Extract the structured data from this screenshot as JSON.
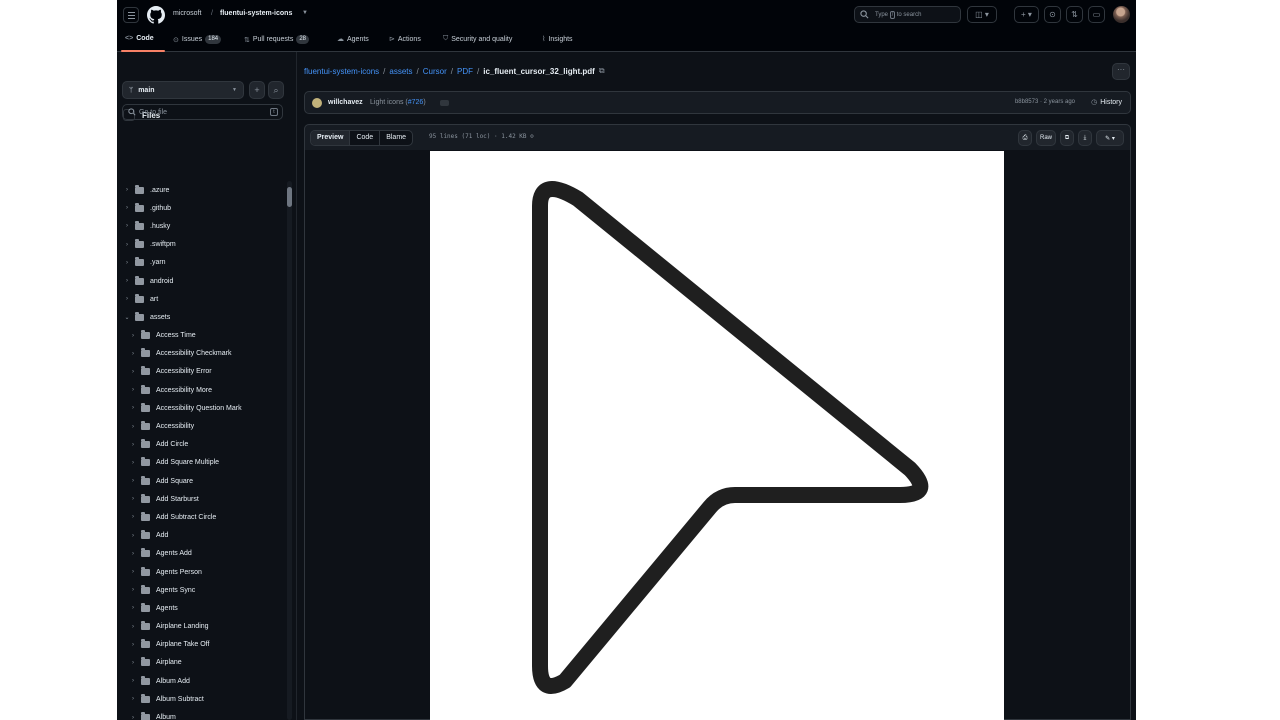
{
  "header": {
    "owner": "microsoft",
    "repo": "fluentui-system-icons",
    "search_placeholder": "Type",
    "search_key": "/",
    "search_suffix": "to search"
  },
  "repo_nav": {
    "tabs": [
      {
        "label": "Code",
        "count": ""
      },
      {
        "label": "Issues",
        "count": "184"
      },
      {
        "label": "Pull requests",
        "count": "28"
      },
      {
        "label": "Agents",
        "count": ""
      },
      {
        "label": "Actions",
        "count": ""
      },
      {
        "label": "Security and quality",
        "count": ""
      },
      {
        "label": "Insights",
        "count": ""
      }
    ]
  },
  "sidebar": {
    "title": "Files",
    "branch": "main",
    "goto_placeholder": "Go to file",
    "goto_key": "t",
    "items": [
      {
        "label": ".azure",
        "level": 0,
        "expanded": false
      },
      {
        "label": ".github",
        "level": 0,
        "expanded": false
      },
      {
        "label": ".husky",
        "level": 0,
        "expanded": false
      },
      {
        "label": ".swiftpm",
        "level": 0,
        "expanded": false
      },
      {
        "label": ".yarn",
        "level": 0,
        "expanded": false
      },
      {
        "label": "android",
        "level": 0,
        "expanded": false
      },
      {
        "label": "art",
        "level": 0,
        "expanded": false
      },
      {
        "label": "assets",
        "level": 0,
        "expanded": true
      },
      {
        "label": "Access Time",
        "level": 1,
        "expanded": false
      },
      {
        "label": "Accessibility Checkmark",
        "level": 1,
        "expanded": false
      },
      {
        "label": "Accessibility Error",
        "level": 1,
        "expanded": false
      },
      {
        "label": "Accessibility More",
        "level": 1,
        "expanded": false
      },
      {
        "label": "Accessibility Question Mark",
        "level": 1,
        "expanded": false
      },
      {
        "label": "Accessibility",
        "level": 1,
        "expanded": false
      },
      {
        "label": "Add Circle",
        "level": 1,
        "expanded": false
      },
      {
        "label": "Add Square Multiple",
        "level": 1,
        "expanded": false
      },
      {
        "label": "Add Square",
        "level": 1,
        "expanded": false
      },
      {
        "label": "Add Starburst",
        "level": 1,
        "expanded": false
      },
      {
        "label": "Add Subtract Circle",
        "level": 1,
        "expanded": false
      },
      {
        "label": "Add",
        "level": 1,
        "expanded": false
      },
      {
        "label": "Agents Add",
        "level": 1,
        "expanded": false
      },
      {
        "label": "Agents Person",
        "level": 1,
        "expanded": false
      },
      {
        "label": "Agents Sync",
        "level": 1,
        "expanded": false
      },
      {
        "label": "Agents",
        "level": 1,
        "expanded": false
      },
      {
        "label": "Airplane Landing",
        "level": 1,
        "expanded": false
      },
      {
        "label": "Airplane Take Off",
        "level": 1,
        "expanded": false
      },
      {
        "label": "Airplane",
        "level": 1,
        "expanded": false
      },
      {
        "label": "Album Add",
        "level": 1,
        "expanded": false
      },
      {
        "label": "Album Subtract",
        "level": 1,
        "expanded": false
      },
      {
        "label": "Album",
        "level": 1,
        "expanded": false
      }
    ]
  },
  "breadcrumb": [
    "fluentui-system-icons",
    "assets",
    "Cursor",
    "PDF"
  ],
  "file_name": "ic_fluent_cursor_32_light.pdf",
  "commit": {
    "author": "willchavez",
    "message": "Light icons (",
    "pr": "#726",
    "message_end": ")",
    "meta": "b8b8573 · 2 years ago",
    "history_label": "History"
  },
  "file_view": {
    "tabs": [
      "Preview",
      "Code",
      "Blame"
    ],
    "info": "95 lines (71 loc) · 1.42 KB",
    "raw_label": "Raw"
  },
  "colors": {
    "background": "#0d1117",
    "header": "#010409",
    "link": "#4493f8",
    "active_tab_underline": "#f78166",
    "cursor_stroke": "#1f1f1f"
  }
}
